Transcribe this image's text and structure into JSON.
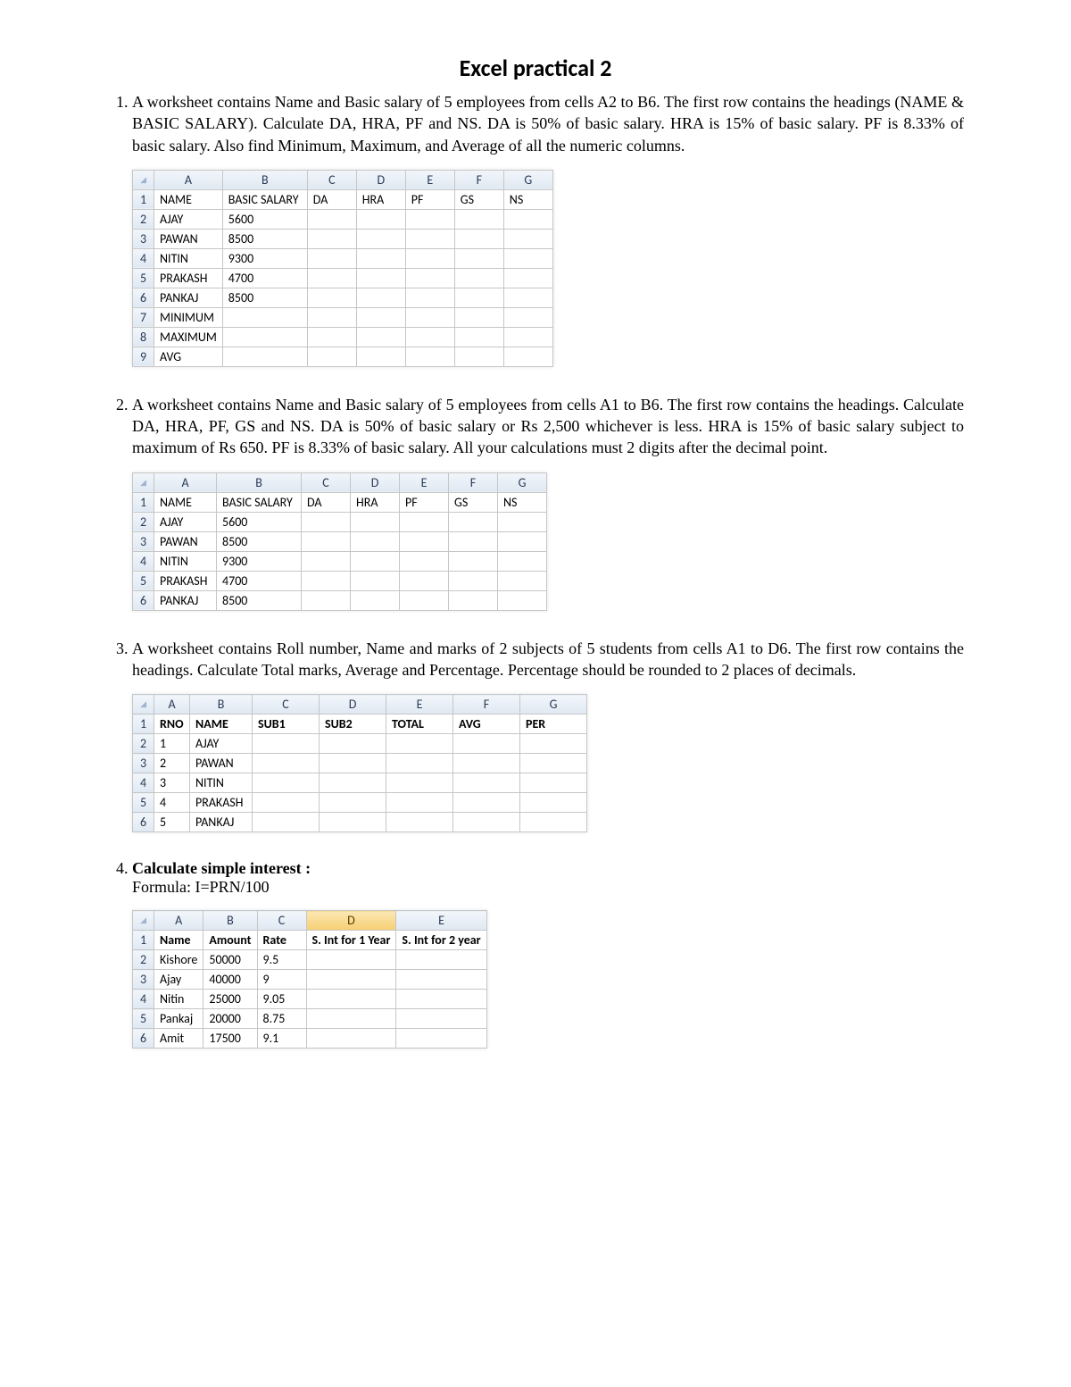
{
  "title": "Excel practical 2",
  "q1": {
    "text": "A worksheet contains Name and Basic salary of 5 employees from cells A2 to B6. The first row contains the headings (NAME & BASIC SALARY). Calculate DA, HRA, PF and NS. DA is 50% of basic salary. HRA is 15% of basic salary. PF is 8.33% of basic salary. Also find Minimum, Maximum, and Average of all the numeric columns.",
    "cols": [
      "A",
      "B",
      "C",
      "D",
      "E",
      "F",
      "G"
    ],
    "headers": [
      "NAME",
      "BASIC SALARY",
      "DA",
      "HRA",
      "PF",
      "GS",
      "NS"
    ],
    "rows": [
      {
        "n": "AJAY",
        "s": "5600"
      },
      {
        "n": "PAWAN",
        "s": "8500"
      },
      {
        "n": "NITIN",
        "s": "9300"
      },
      {
        "n": "PRAKASH",
        "s": "4700"
      },
      {
        "n": "PANKAJ",
        "s": "8500"
      },
      {
        "n": "MINIMUM",
        "s": ""
      },
      {
        "n": "MAXIMUM",
        "s": ""
      },
      {
        "n": "AVG",
        "s": ""
      }
    ]
  },
  "q2": {
    "text": "A worksheet contains Name and Basic salary of 5 employees from cells A1 to B6. The first row contains the headings. Calculate DA, HRA, PF, GS and NS. DA is 50% of basic salary or Rs 2,500 whichever is less. HRA is 15% of basic salary subject to maximum of Rs 650. PF is 8.33% of basic salary. All your calculations must 2 digits after the decimal point.",
    "cols": [
      "A",
      "B",
      "C",
      "D",
      "E",
      "F",
      "G"
    ],
    "headers": [
      "NAME",
      "BASIC SALARY",
      "DA",
      "HRA",
      "PF",
      "GS",
      "NS"
    ],
    "rows": [
      {
        "n": "AJAY",
        "s": "5600"
      },
      {
        "n": "PAWAN",
        "s": "8500"
      },
      {
        "n": "NITIN",
        "s": "9300"
      },
      {
        "n": "PRAKASH",
        "s": "4700"
      },
      {
        "n": "PANKAJ",
        "s": "8500"
      }
    ]
  },
  "q3": {
    "text": "A worksheet contains Roll number, Name and marks of 2 subjects of 5 students from cells A1 to D6. The first row contains the headings. Calculate Total marks, Average and Percentage. Percentage should be rounded to 2 places of decimals.",
    "cols": [
      "A",
      "B",
      "C",
      "D",
      "E",
      "F",
      "G"
    ],
    "headers": [
      "RNO",
      "NAME",
      "SUB1",
      "SUB2",
      "TOTAL",
      "AVG",
      "PER"
    ],
    "rows": [
      {
        "r": "1",
        "n": "AJAY"
      },
      {
        "r": "2",
        "n": "PAWAN"
      },
      {
        "r": "3",
        "n": "NITIN"
      },
      {
        "r": "4",
        "n": "PRAKASH"
      },
      {
        "r": "5",
        "n": "PANKAJ"
      }
    ]
  },
  "q4": {
    "heading": "Calculate simple interest :",
    "formula": "Formula: I=PRN/100",
    "cols": [
      "A",
      "B",
      "C",
      "D",
      "E"
    ],
    "headers": [
      "Name",
      "Amount",
      "Rate",
      "S. Int for 1 Year",
      "S. Int for 2 year"
    ],
    "activeCol": 3,
    "rows": [
      {
        "n": "Kishore",
        "a": "50000",
        "r": "9.5"
      },
      {
        "n": "Ajay",
        "a": "40000",
        "r": "9"
      },
      {
        "n": "Nitin",
        "a": "25000",
        "r": "9.05"
      },
      {
        "n": "Pankaj",
        "a": "20000",
        "r": "8.75"
      },
      {
        "n": "Amit",
        "a": "17500",
        "r": "9.1"
      }
    ]
  }
}
